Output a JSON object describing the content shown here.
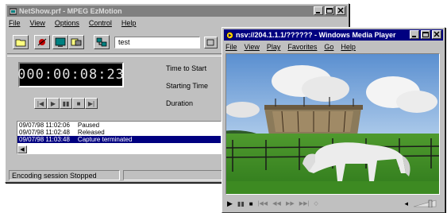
{
  "netshow": {
    "title": "NetShow.prf - MPEG EzMotion",
    "menu": [
      "File",
      "View",
      "Options",
      "Control",
      "Help"
    ],
    "input_value": "test",
    "timer": "000:00:08:23",
    "labels": {
      "time_to_start": "Time to Start",
      "starting_time": "Starting Time",
      "duration": "Duration"
    },
    "log": [
      {
        "time": "09/07/98 11:02:06",
        "event": "Paused"
      },
      {
        "time": "09/07/98 11:02:48",
        "event": "Released"
      },
      {
        "time": "09/07/98 11:03:48",
        "event": "Capture terminated"
      }
    ],
    "status": "Encoding session Stopped"
  },
  "mediaplayer": {
    "title": "nsv://204.1.1.1/?????? - Windows Media Player",
    "menu": [
      "File",
      "View",
      "Play",
      "Favorites",
      "Go",
      "Help"
    ]
  },
  "colors": {
    "title_active": "#000080",
    "title_inactive": "#808080",
    "window_face": "#c0c0c0",
    "lcd_bg": "#000000",
    "selection": "#000080"
  }
}
